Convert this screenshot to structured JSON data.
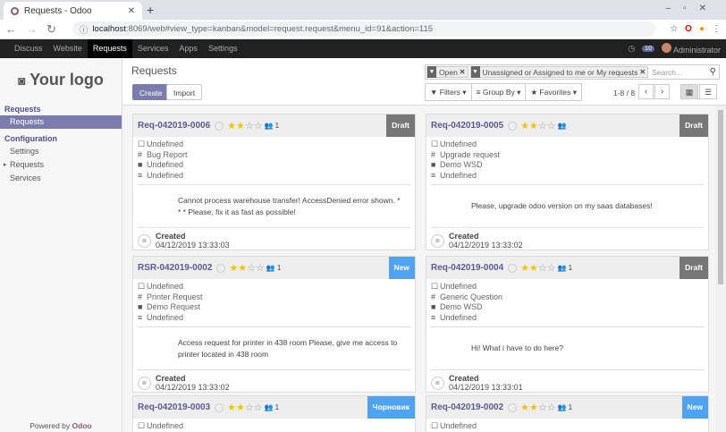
{
  "browser": {
    "tab_title": "Requests - Odoo",
    "url_host": "localhost",
    "url_rest": ":8069/web#view_type=kanban&model=request.request&menu_id=91&action=115"
  },
  "topnav": {
    "items": [
      "Discuss",
      "Website",
      "Requests",
      "Services",
      "Apps",
      "Settings"
    ],
    "active": 2,
    "messages": "10",
    "user": "Administrator"
  },
  "sidebar": {
    "logo": "Your logo",
    "sections": [
      {
        "title": "Requests",
        "items": [
          "Requests"
        ]
      },
      {
        "title": "Configuration",
        "items": [
          "Settings",
          "Requests",
          "Services"
        ]
      }
    ],
    "powered_by": "Powered by",
    "brand": "Odoo"
  },
  "main": {
    "title": "Requests",
    "create": "Create",
    "import": "Import",
    "facets": [
      "Open",
      "Unassigned or Assigned to me or My requests"
    ],
    "search_placeholder": "Search...",
    "filters": "Filters",
    "group_by": "Group By",
    "favorites": "Favorites",
    "pager": "1-8 / 8"
  },
  "colors": {
    "draft": "#777777",
    "new": "#4ea4f2"
  },
  "cards": [
    {
      "name": "Req-042019-0006",
      "stars": 2,
      "followers": "1",
      "stage": "Draft",
      "stage_color": "#777777",
      "fields": [
        "Undefined",
        "Bug Report",
        "Undefined",
        "Undefined"
      ],
      "desc": "Cannot process warehouse transfer! AccessDenied error shown. * * * Please, fix it as fast as possible!",
      "created_label": "Created",
      "created": "04/12/2019 13:33:03"
    },
    {
      "name": "Req-042019-0005",
      "stars": 2,
      "followers": "",
      "stage": "Draft",
      "stage_color": "#777777",
      "fields": [
        "Undefined",
        "Upgrade request",
        "Demo WSD",
        "Undefined"
      ],
      "desc": "Please, upgrade odoo version on my saas databases!",
      "created_label": "Created",
      "created": "04/12/2019 13:33:02"
    },
    {
      "name": "RSR-042019-0002",
      "stars": 2,
      "followers": "1",
      "stage": "New",
      "stage_color": "#4ea4f2",
      "fields": [
        "Undefined",
        "Printer Request",
        "Demo Request",
        "Undefined"
      ],
      "desc": "Access request for printer in 438 room Please, give me access to printer located in 438 room",
      "created_label": "Created",
      "created": "04/12/2019 13:33:02"
    },
    {
      "name": "Req-042019-0004",
      "stars": 2,
      "followers": "1",
      "stage": "Draft",
      "stage_color": "#777777",
      "fields": [
        "Undefined",
        "Generic Question",
        "Demo WSD",
        "Undefined"
      ],
      "desc": "Hi! What i have to do here?",
      "created_label": "Created",
      "created": "04/12/2019 13:33:01"
    },
    {
      "name": "Req-042019-0003",
      "stars": 2,
      "followers": "1",
      "stage": "Чорновик",
      "stage_color": "#4ea4f2",
      "fields": [
        "Undefined"
      ],
      "desc": "",
      "created_label": "",
      "created": ""
    },
    {
      "name": "Req-042019-0002",
      "stars": 2,
      "followers": "1",
      "stage": "New",
      "stage_color": "#4ea4f2",
      "fields": [
        "Undefined"
      ],
      "desc": "",
      "created_label": "",
      "created": ""
    }
  ]
}
